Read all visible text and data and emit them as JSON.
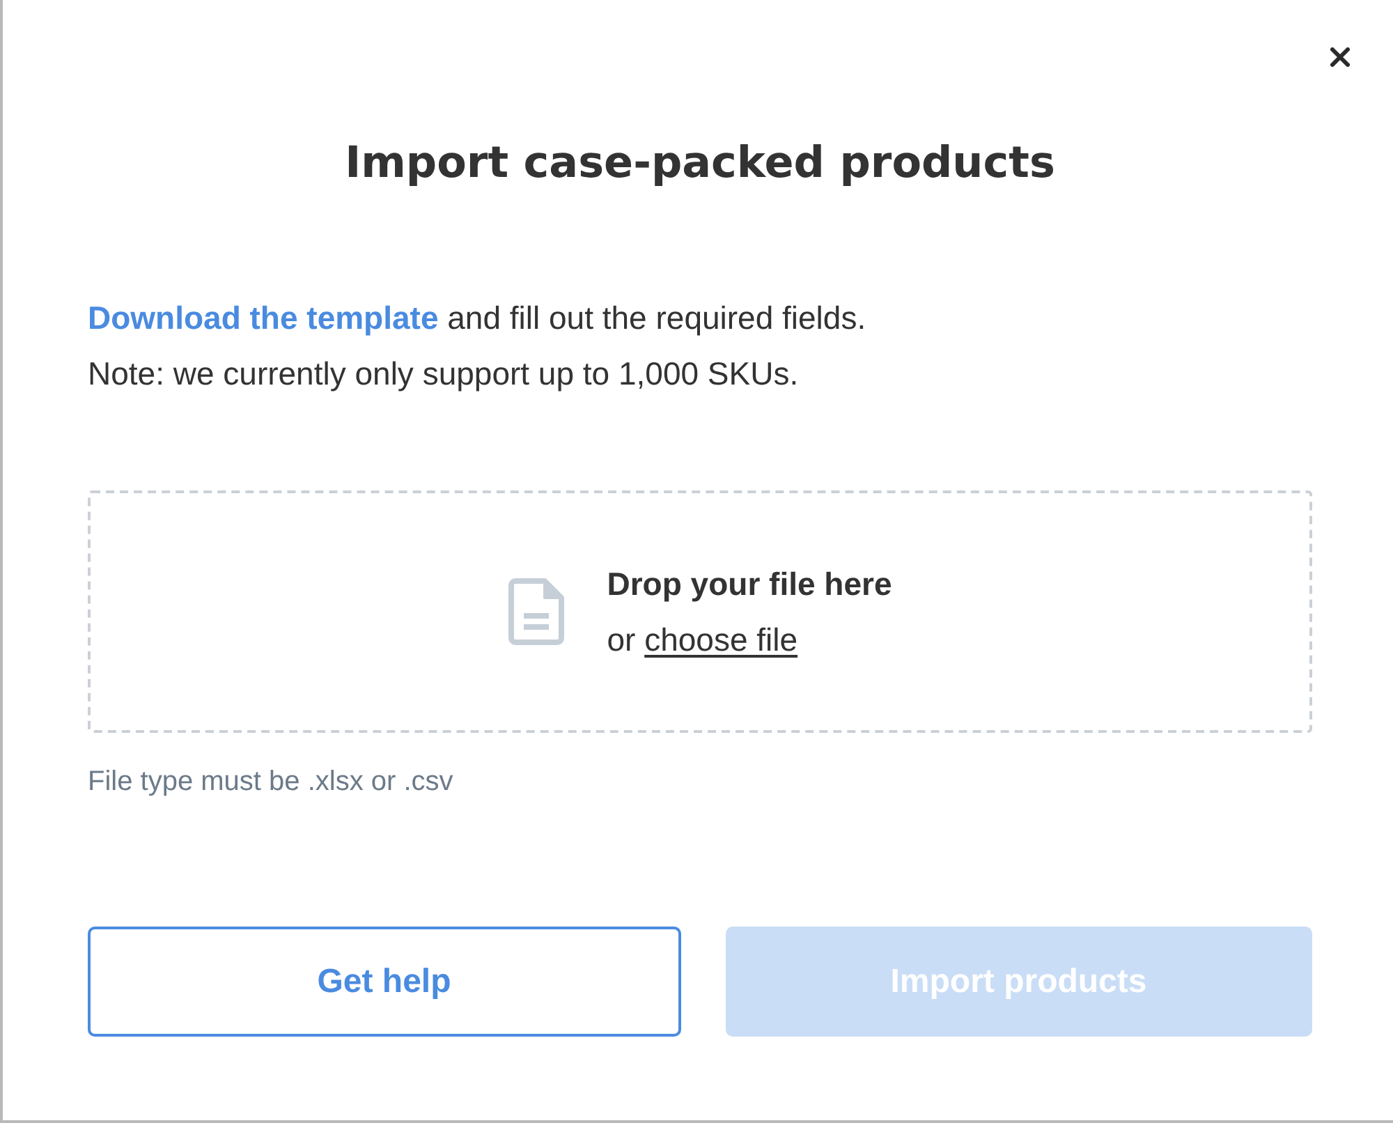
{
  "dialog": {
    "title": "Import case-packed products"
  },
  "intro": {
    "link": "Download the template",
    "text": " and fill out the required fields."
  },
  "note": "Note: we currently only support up to 1,000 SKUs.",
  "dropzone": {
    "heading": "Drop your file here",
    "prefix": "or ",
    "link": "choose file"
  },
  "hint": "File type must be .xlsx or .csv",
  "buttons": [
    {
      "label": "Get help",
      "kind": "outline",
      "disabled": false
    },
    {
      "label": "Import products",
      "kind": "filled",
      "disabled": true
    }
  ]
}
